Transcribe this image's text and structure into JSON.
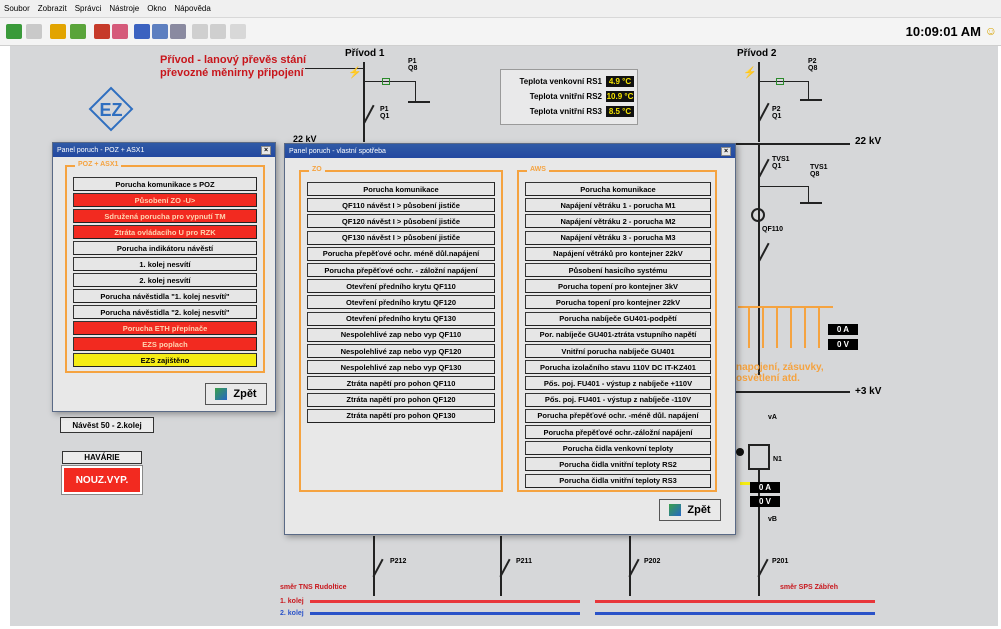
{
  "menu": [
    "Soubor",
    "Zobrazit",
    "Správci",
    "Nástroje",
    "Okno",
    "Nápověda"
  ],
  "clock": "10:09:01 AM",
  "logo": "EZ",
  "feed_title_line1": "Přívod - lanový převěs stání",
  "feed_title_line2": "převozné měnirny připojení",
  "privod1": "Přívod 1",
  "privod2": "Přívod 2",
  "labels": {
    "p1q8": "P1\nQ8",
    "p1q1": "P1\nQ1",
    "p2q8": "P2\nQ8",
    "p2q1": "P2\nQ1",
    "tvs1q1": "TVS1\nQ1",
    "tvs1q8": "TVS1\nQ8",
    "qf110": "QF110",
    "kv22": "22 kV",
    "kv22_left": "22 kV",
    "kv3": "+3 kV",
    "va": "vA",
    "vb": "vB",
    "n1": "N1",
    "p212": "P212",
    "p211": "P211",
    "p202": "P202",
    "p201": "P201",
    "smer_tns": "směr TNS Rudoltice",
    "smer_sps": "směr SPS Zábřeh",
    "kolej1": "1. kolej",
    "kolej2": "2. kolej",
    "loads_text": "napojení, zásuvky, osvětlení atd."
  },
  "temps": [
    {
      "label": "Teplota venkovní RS1",
      "value": "4.9 °C"
    },
    {
      "label": "Teplota vnitřní RS2",
      "value": "10.9 °C"
    },
    {
      "label": "Teplota vnitřní RS3",
      "value": "8.5 °C"
    }
  ],
  "meters": {
    "a1": "0 A",
    "v1": "0 V",
    "a2": "0 A",
    "v2": "0 V"
  },
  "poz_window": {
    "title": "Panel poruch - POZ + ASX1",
    "group": "POZ + ASX1",
    "buttons": [
      {
        "label": "Porucha komunikace s POZ",
        "state": "normal"
      },
      {
        "label": "Působení ZO -U>",
        "state": "red"
      },
      {
        "label": "Sdružená porucha pro vypnutí TM",
        "state": "red"
      },
      {
        "label": "Ztráta ovládacího U pro RZK",
        "state": "red"
      },
      {
        "label": "Porucha indikátoru návěstí",
        "state": "normal"
      },
      {
        "label": "1. kolej nesvítí",
        "state": "normal"
      },
      {
        "label": "2. kolej nesvítí",
        "state": "normal"
      },
      {
        "label": "Porucha návěstidla \"1. kolej nesvítí\"",
        "state": "normal"
      },
      {
        "label": "Porucha návěstidla \"2. kolej nesvítí\"",
        "state": "normal"
      },
      {
        "label": "Porucha ETH přepínače",
        "state": "red"
      },
      {
        "label": "EZS poplach",
        "state": "red"
      },
      {
        "label": "EZS zajištěno",
        "state": "yellow"
      }
    ],
    "back": "Zpět"
  },
  "own_window": {
    "title": "Panel poruch - vlastní spotřeba",
    "group_left": "ZO",
    "group_right": "AWS",
    "left_buttons": [
      "Porucha komunikace",
      "QF110 návěst I > působení jističe",
      "QF120 návěst I > působení jističe",
      "QF130 návěst I > působení jističe",
      "Porucha přepěťové ochr. méně důl.napájení",
      "Porucha přepěťové ochr. - záložní napájení",
      "Otevření předního krytu QF110",
      "Otevření předního krytu QF120",
      "Otevření předního krytu QF130",
      "Nespolehlivé zap nebo vyp QF110",
      "Nespolehlivé zap nebo vyp QF120",
      "Nespolehlivé zap nebo vyp QF130",
      "Ztráta napětí pro pohon QF110",
      "Ztráta napětí pro pohon QF120",
      "Ztráta napětí pro pohon QF130"
    ],
    "right_buttons": [
      "Porucha komunikace",
      "Napájení větráku 1 - porucha M1",
      "Napájení větráku 2 - porucha M2",
      "Napájení větráku 3 - porucha M3",
      "Napájení větráků pro kontejner 22kV",
      "Působení hasicího systému",
      "Porucha topení pro kontejner 3kV",
      "Porucha topení pro kontejner 22kV",
      "Porucha nabíječe GU401-podpětí",
      "Por. nabíječe GU401-ztráta vstupního napětí",
      "Vnitřní porucha nabíječe GU401",
      "Porucha izolačního stavu 110V DC IT-KZ401",
      "Pős. poj. FU401 - výstup z nabíječe +110V",
      "Pős. poj. FU401 - výstup z nabíječe -110V",
      "Porucha přepěťové ochr. -méně důl. napájení",
      "Porucha přepěťové ochr.-záložní napájení",
      "Porucha čidla venkovní teploty",
      "Porucha čidla vnitřní teploty RS2",
      "Porucha čidla vnitřní teploty RS3"
    ],
    "back": "Zpět"
  },
  "navest": "Návěst 50 - 2.kolej",
  "havarie": "HAVÁRIE",
  "nouz": "NOUZ.VYP."
}
